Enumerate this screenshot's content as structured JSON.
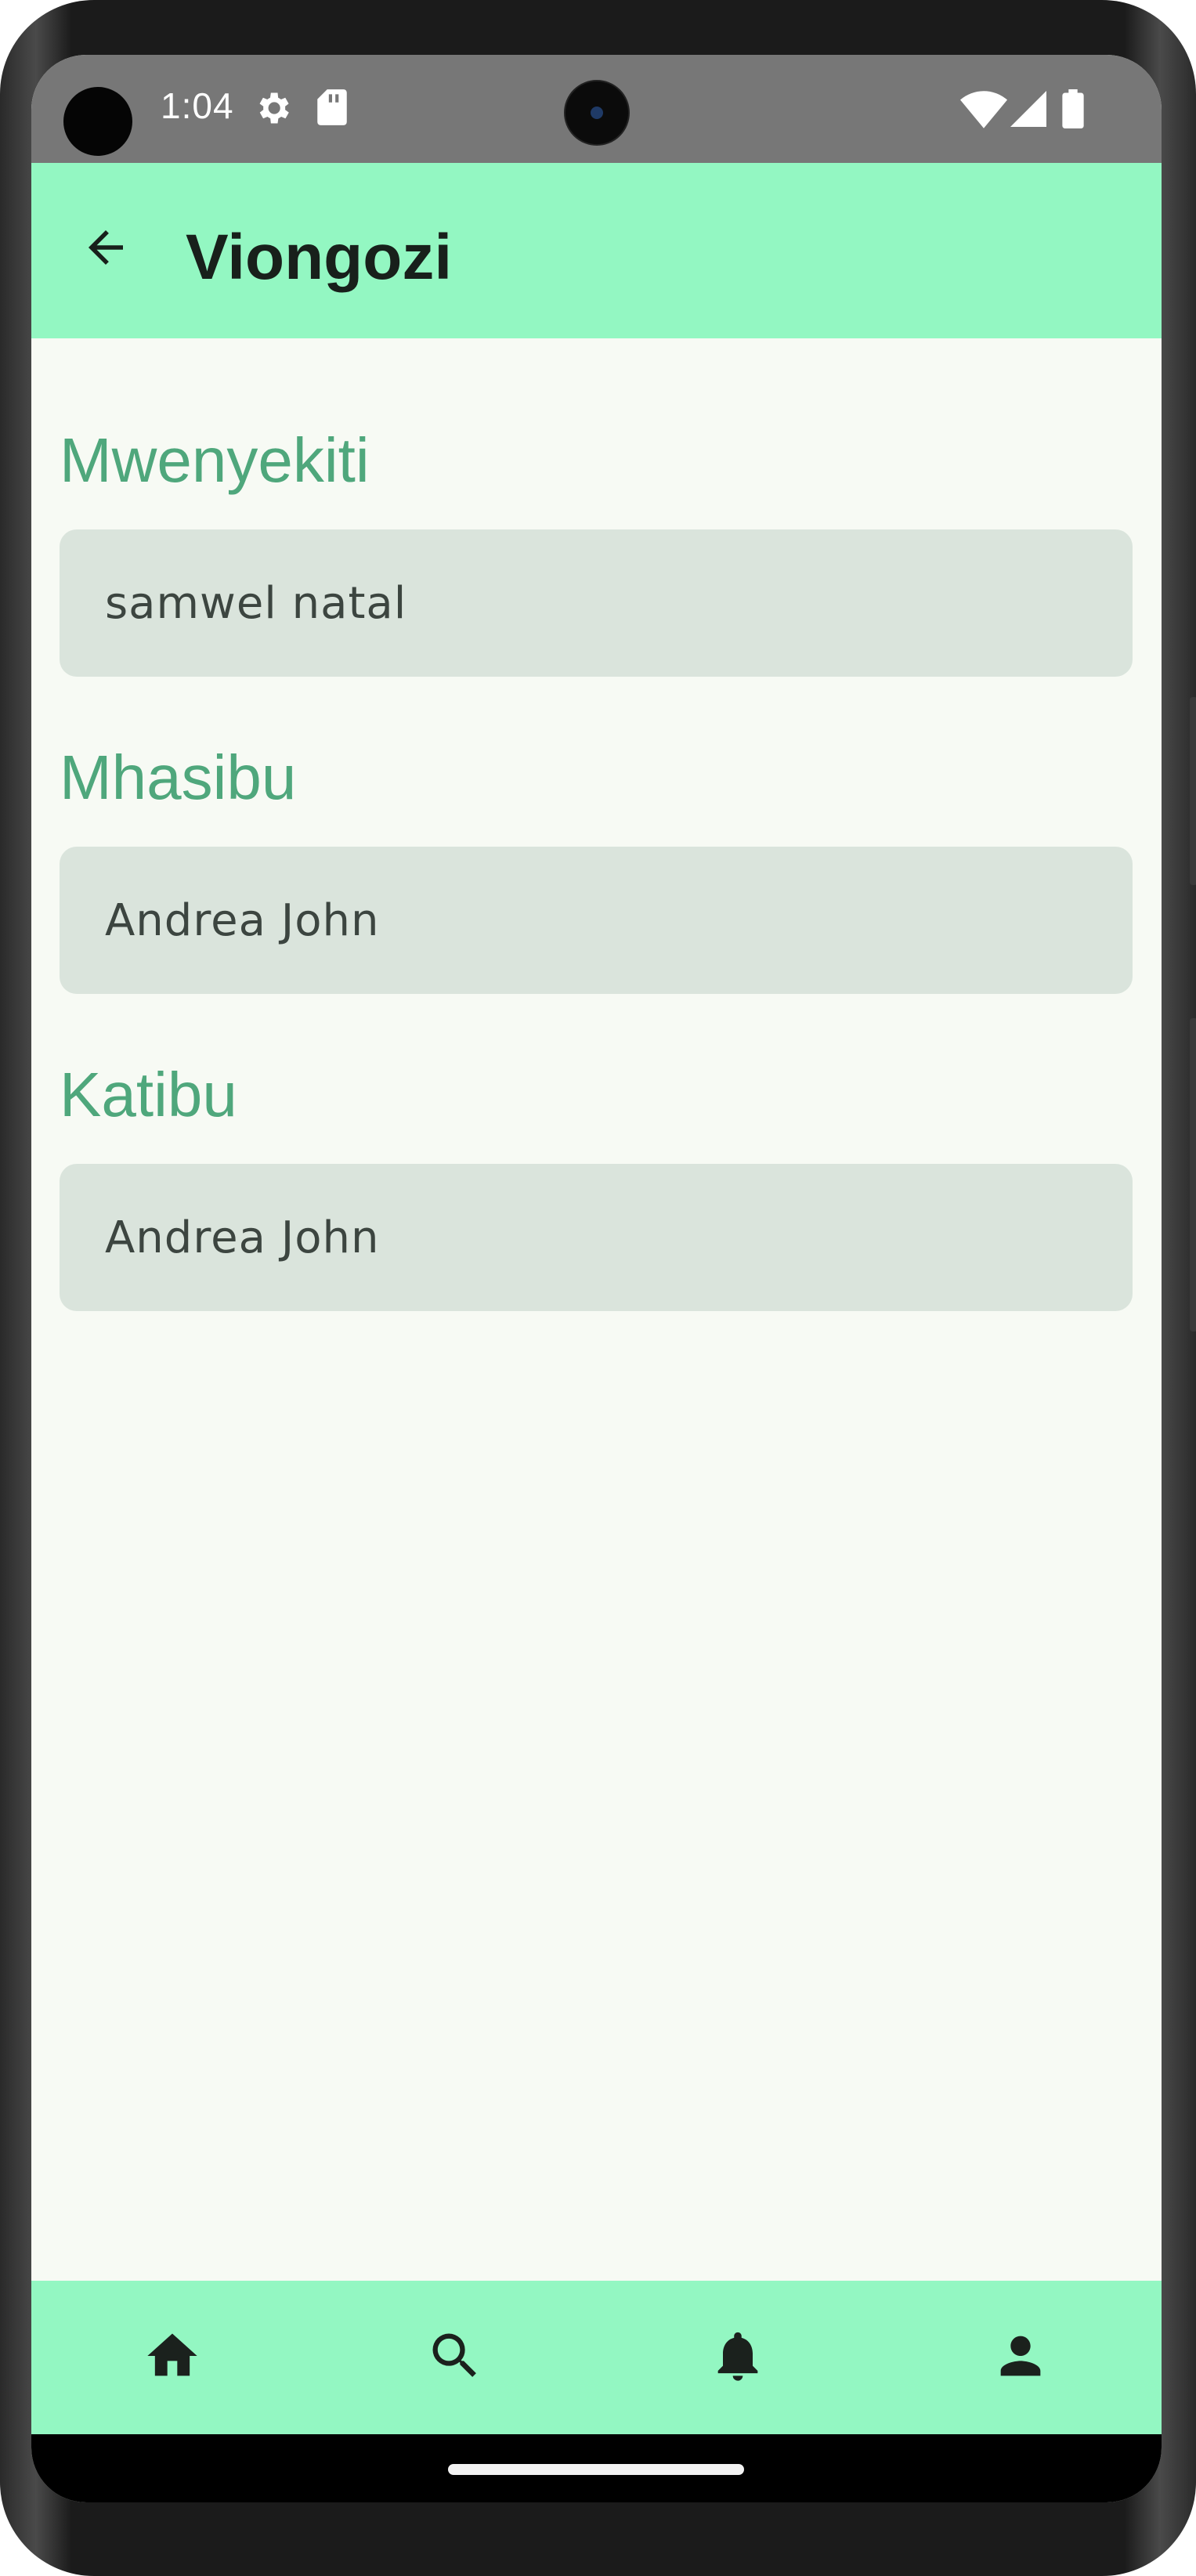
{
  "status_bar": {
    "time": "1:04",
    "icons": [
      "settings-gear-icon",
      "sd-card-icon",
      "wifi-icon",
      "cell-signal-icon",
      "battery-icon"
    ]
  },
  "app_bar": {
    "title": "Viongozi",
    "back_icon": "arrow-back-icon"
  },
  "sections": [
    {
      "label": "Mwenyekiti",
      "value": "samwel natal"
    },
    {
      "label": "Mhasibu",
      "value": "Andrea John"
    },
    {
      "label": "Katibu",
      "value": "Andrea John"
    }
  ],
  "bottom_nav": {
    "items": [
      {
        "icon": "home-icon"
      },
      {
        "icon": "search-icon"
      },
      {
        "icon": "notifications-bell-icon"
      },
      {
        "icon": "person-icon"
      }
    ]
  },
  "colors": {
    "app_bar": "#93f7c2",
    "accent_label": "#4fa77c",
    "field_background": "#dae4dc",
    "page_background": "#f7faf4",
    "status_bar": "#777777"
  }
}
